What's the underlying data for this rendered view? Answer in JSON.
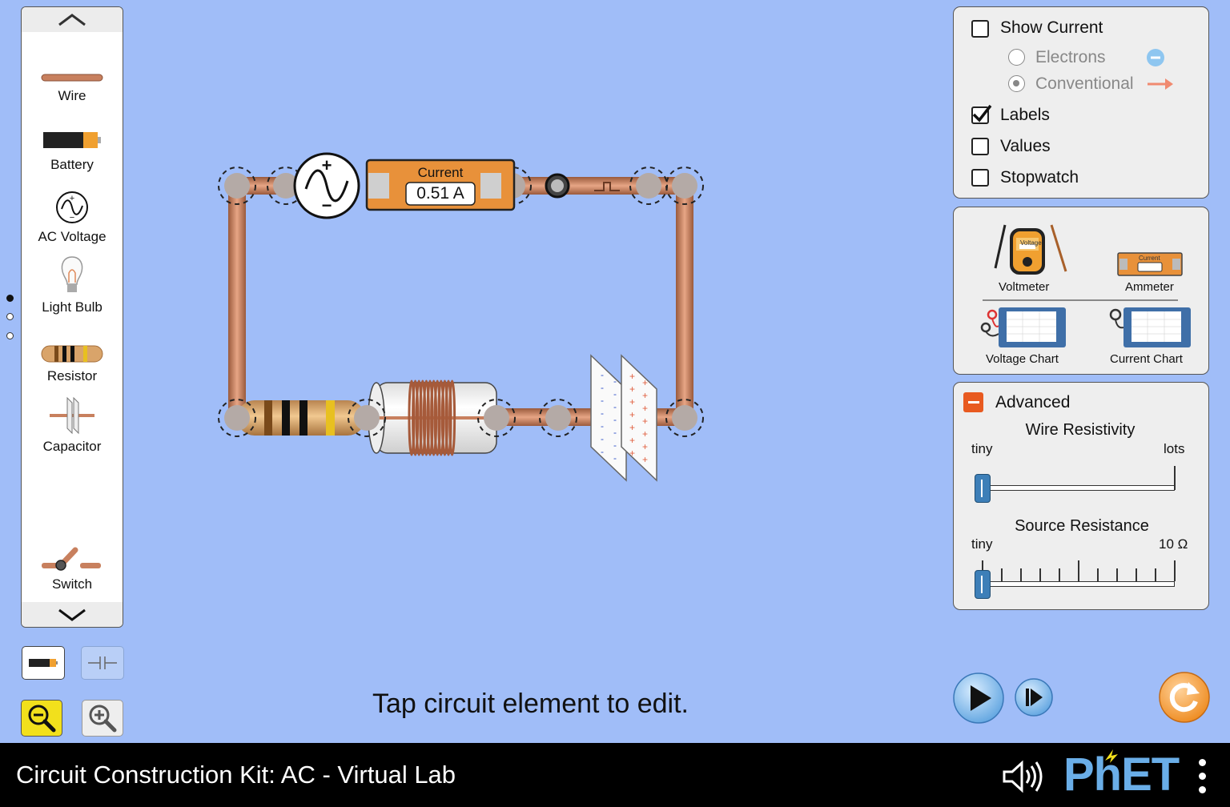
{
  "palette": {
    "items": [
      {
        "label": "Wire",
        "icon": "wire-icon"
      },
      {
        "label": "Battery",
        "icon": "battery-icon"
      },
      {
        "label": "AC Voltage",
        "icon": "ac-voltage-icon"
      },
      {
        "label": "Light Bulb",
        "icon": "light-bulb-icon"
      },
      {
        "label": "Resistor",
        "icon": "resistor-icon"
      },
      {
        "label": "Capacitor",
        "icon": "capacitor-icon"
      },
      {
        "label": "Switch",
        "icon": "switch-icon"
      }
    ]
  },
  "circuit": {
    "ammeter_title": "Current",
    "ammeter_value": "0.51 A"
  },
  "display_panel": {
    "show_current": {
      "label": "Show Current",
      "checked": false
    },
    "electrons": {
      "label": "Electrons",
      "selected": false
    },
    "conventional": {
      "label": "Conventional",
      "selected": true
    },
    "labels": {
      "label": "Labels",
      "checked": true
    },
    "values": {
      "label": "Values",
      "checked": false
    },
    "stopwatch": {
      "label": "Stopwatch",
      "checked": false
    }
  },
  "tools_panel": {
    "voltmeter": "Voltmeter",
    "voltmeter_screen": "Voltage",
    "ammeter": "Ammeter",
    "ammeter_screen": "Current",
    "voltage_chart": "Voltage Chart",
    "current_chart": "Current Chart"
  },
  "advanced_panel": {
    "title": "Advanced",
    "wire_resistivity": {
      "title": "Wire Resistivity",
      "min_label": "tiny",
      "max_label": "lots",
      "value_fraction": 0
    },
    "source_resistance": {
      "title": "Source Resistance",
      "min_label": "tiny",
      "max_label": "10 Ω",
      "value_fraction": 0
    }
  },
  "hint": "Tap circuit element to edit.",
  "footer": {
    "title": "Circuit Construction Kit: AC - Virtual Lab",
    "brand": "PhET"
  },
  "colors": {
    "background": "#a0bdf8",
    "wire": "#c8805e",
    "ammeter_orange": "#e8913a",
    "accent_yellow": "#f2e01c",
    "reset_orange": "#f0a030"
  }
}
